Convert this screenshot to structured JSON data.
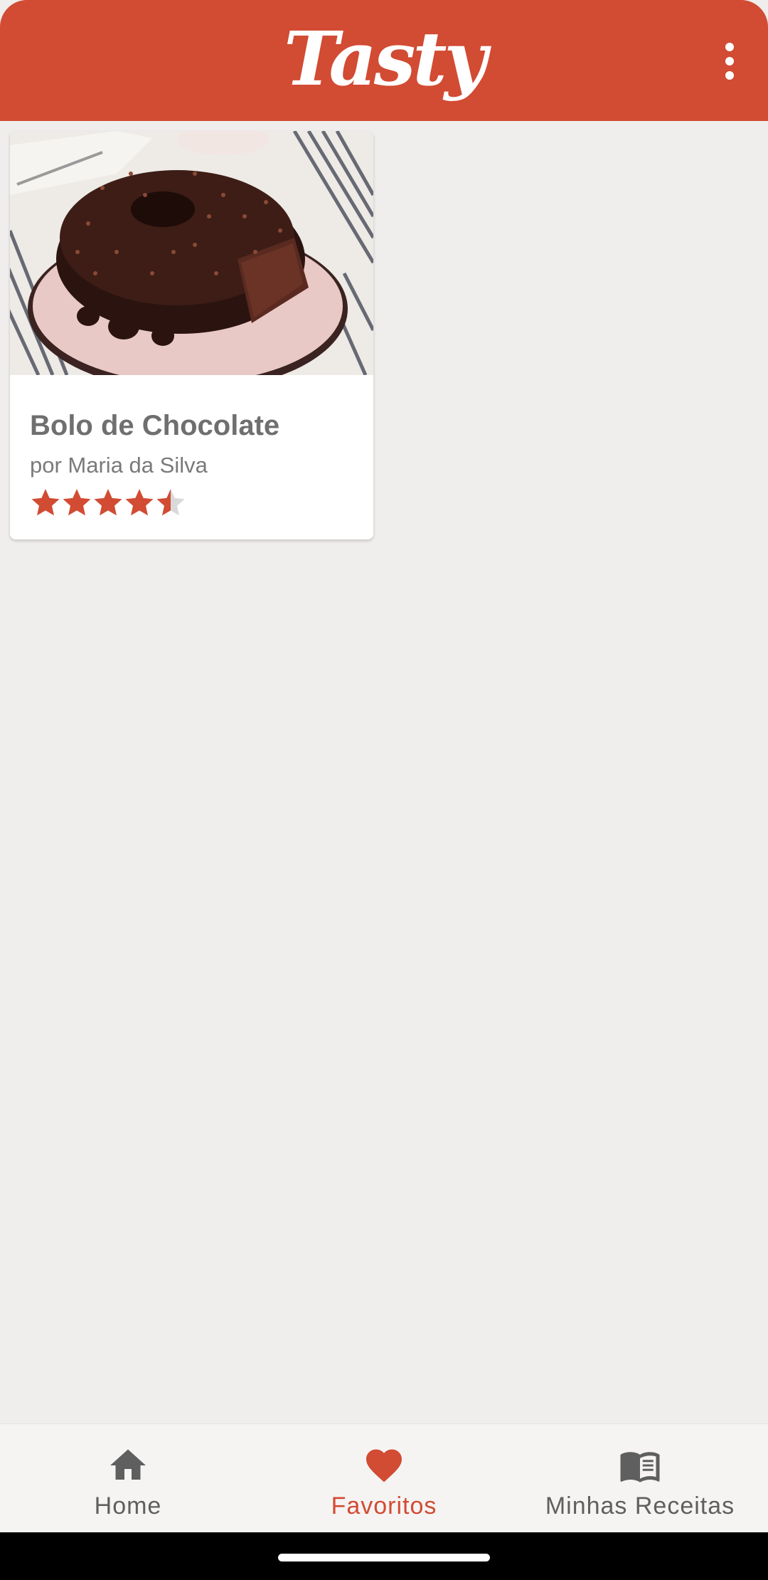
{
  "app": {
    "logo_text": "Tasty",
    "brand_color": "#d24b33"
  },
  "header": {
    "menu_icon": "more-vert-icon"
  },
  "recipes": [
    {
      "title": "Bolo de Chocolate",
      "author": "por Maria da Silva",
      "rating": 4.5,
      "rating_max": 5,
      "image": "chocolate-bundt-cake-photo"
    }
  ],
  "bottom_nav": {
    "items": [
      {
        "label": "Home",
        "icon": "home-icon",
        "active": false
      },
      {
        "label": "Favoritos",
        "icon": "heart-icon",
        "active": true
      },
      {
        "label": "Minhas Receitas",
        "icon": "book-icon",
        "active": false
      }
    ],
    "active_color": "#d24b33",
    "inactive_color": "#5f5f5f"
  }
}
